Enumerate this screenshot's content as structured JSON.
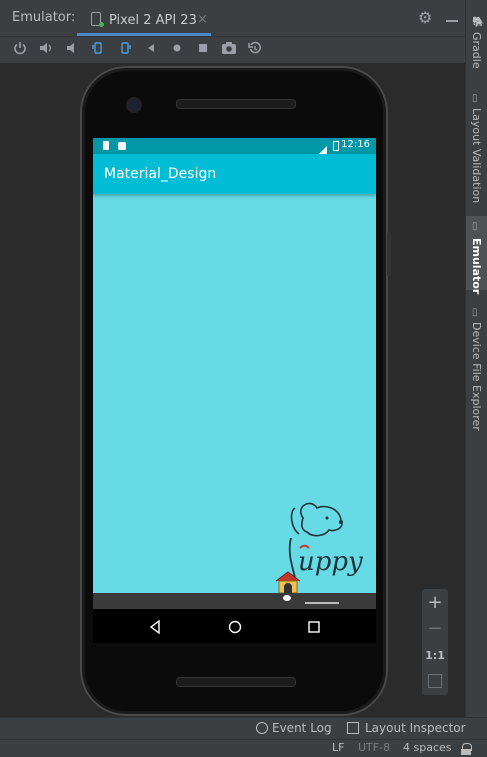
{
  "window": {
    "tool_label": "Emulator:",
    "tab_title": "Pixel 2 API 23",
    "tab_close": "×"
  },
  "side_tabs": {
    "gradle": "Gradle",
    "layout_validation": "Layout Validation",
    "emulator": "Emulator",
    "device_file_explorer": "Device File Explorer"
  },
  "toolbar": {
    "icons": [
      "power-icon",
      "volume-up-icon",
      "volume-down-icon",
      "rotate-left-icon",
      "rotate-right-icon",
      "back-icon",
      "home-icon",
      "overview-icon",
      "screenshot-icon",
      "snapshot-icon"
    ]
  },
  "device": {
    "status_time": "12:16",
    "app_title": "Material_Design",
    "logo_text": "uppy"
  },
  "zoom": {
    "plus": "+",
    "minus": "−",
    "one_to_one": "1:1"
  },
  "bottom_tools": {
    "event_log": "Event Log",
    "layout_inspector": "Layout Inspector"
  },
  "status_bar": {
    "line_sep": "LF",
    "encoding": "UTF-8",
    "indent": "4 spaces"
  },
  "colors": {
    "status_bar": "#0097a7",
    "app_bar": "#00bcd4",
    "screen_bg": "#66dbe6",
    "ide_panel": "#3c3f41",
    "tab_accent": "#4a88c7"
  }
}
